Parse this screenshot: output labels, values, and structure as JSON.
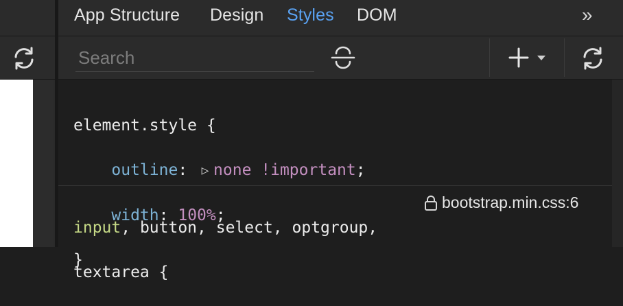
{
  "tabs": [
    {
      "label": "App Structure"
    },
    {
      "label": "Design"
    },
    {
      "label": "Styles",
      "active": true
    },
    {
      "label": "DOM"
    }
  ],
  "overflow_label": "»",
  "search": {
    "placeholder": "Search",
    "value": ""
  },
  "toolbar": {
    "add_label": "+",
    "icons": [
      "strikethrough-filter-icon",
      "add-rule-icon",
      "chevron-down-icon",
      "refresh-icon"
    ]
  },
  "rules": [
    {
      "selector": "element.style",
      "open_brace": "{",
      "close_brace": "}",
      "declarations": [
        {
          "property": "outline",
          "value": "none !important"
        },
        {
          "property": "width",
          "value": "100%"
        }
      ]
    },
    {
      "selector_parts": [
        "input",
        ", button, select, optgroup,"
      ],
      "selector_line2": "textarea {",
      "source": "bootstrap.min.css:6"
    }
  ],
  "colors": {
    "accent": "#5aa2f2",
    "property": "#7db3d6",
    "value": "#c48fc0",
    "matched_selector": "#c5d986",
    "background": "#1e1e1e",
    "toolbar": "#2b2b2b"
  }
}
